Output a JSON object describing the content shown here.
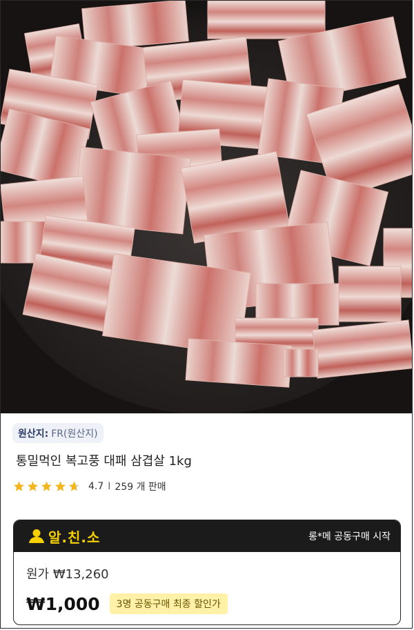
{
  "photo": {
    "alt": "pork-belly-photo"
  },
  "origin": {
    "label": "원산지:",
    "value": "FR(원산지)"
  },
  "product": {
    "title": "통밀먹인 복고풍  대패 삼겹살 1kg"
  },
  "rating": {
    "score": "4.7",
    "separator": "I",
    "sold": "259 개 판매",
    "stars_value": 4.7,
    "stars_max": 5,
    "star_color": "#f3b61f"
  },
  "deal": {
    "brand": "알.친.소",
    "started_text": "롱*메 공동구매 시작",
    "original_price": "원가 ₩13,260",
    "price": "₩1,000",
    "badge": "3명 공동구매  최종 할인가",
    "brand_color": "#f7d000"
  }
}
